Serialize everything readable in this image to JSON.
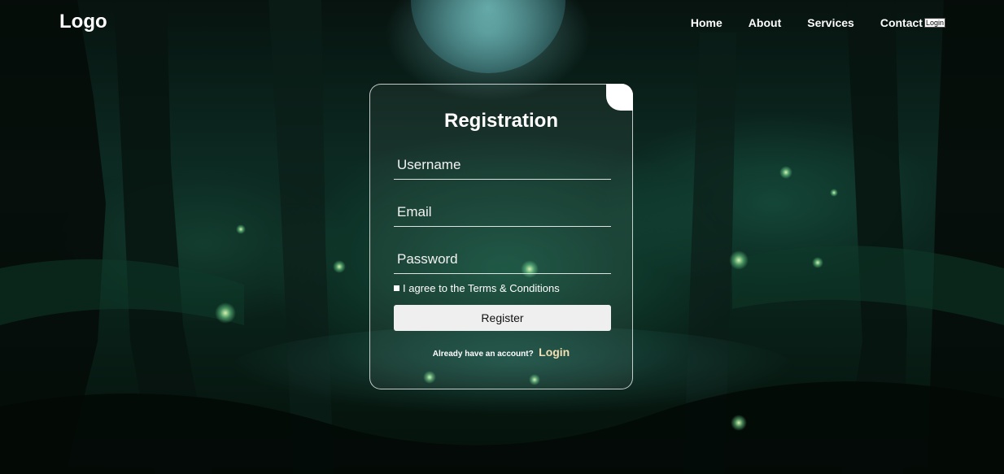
{
  "header": {
    "logo": "Logo",
    "nav": {
      "home": "Home",
      "about": "About",
      "services": "Services",
      "contact": "Contact",
      "login_button": "Login"
    }
  },
  "registration": {
    "title": "Registration",
    "username_placeholder": "Username",
    "email_placeholder": "Email",
    "password_placeholder": "Password",
    "agree_label": "I agree to the Terms & Conditions",
    "register_button": "Register",
    "login_prompt": "Already have an account?",
    "login_link": "Login",
    "close_icon": "close-corner-icon"
  },
  "colors": {
    "login_link": "#f4dfb2",
    "button_bg": "#efefef",
    "card_border": "#ffffff"
  }
}
